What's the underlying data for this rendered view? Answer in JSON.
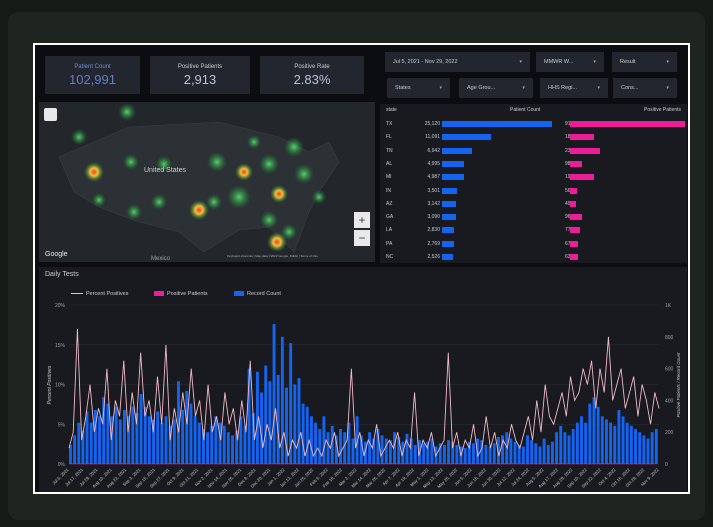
{
  "scorecards": [
    {
      "label": "Patient Count",
      "value": "102,991",
      "accent": "#5f7fc6"
    },
    {
      "label": "Positive Patients",
      "value": "2,913",
      "accent": "#b8c1d6"
    },
    {
      "label": "Positive Rate",
      "value": "2.83%",
      "accent": "#b8c1d6"
    }
  ],
  "filters": {
    "date_range": "Jul 5, 2021 - Nov 29, 2022",
    "mmwr": "MMWR W...",
    "result": "Result",
    "states": "States",
    "age_group": "Age Grou...",
    "hhs_region": "HHS Regi...",
    "cons": "Cons..."
  },
  "map": {
    "brand": "Google",
    "country_label": "United States",
    "country_label_2": "Mexico",
    "attribution": "Keyboard shortcuts | Map data ©2022 Google, INEGI | Terms of Use",
    "zoom_in": "+",
    "zoom_out": "−"
  },
  "table": {
    "col_state": "state",
    "col_patient_count": "Patient Count",
    "col_positive_patients": "Positive Patients",
    "max_patient": 25120,
    "max_positive": 915,
    "rows": [
      {
        "state": "TX",
        "patients": "25,120",
        "patients_n": 25120,
        "positives": "915",
        "positives_n": 915
      },
      {
        "state": "FL",
        "patients": "11,091",
        "patients_n": 11091,
        "positives": "187",
        "positives_n": 187
      },
      {
        "state": "TN",
        "patients": "6,942",
        "patients_n": 6942,
        "positives": "235",
        "positives_n": 235
      },
      {
        "state": "AL",
        "patients": "4,995",
        "patients_n": 4995,
        "positives": "98",
        "positives_n": 98
      },
      {
        "state": "MI",
        "patients": "4,987",
        "patients_n": 4987,
        "positives": "193",
        "positives_n": 193
      },
      {
        "state": "IN",
        "patients": "3,501",
        "patients_n": 3501,
        "positives": "56",
        "positives_n": 56
      },
      {
        "state": "AZ",
        "patients": "3,142",
        "patients_n": 3142,
        "positives": "49",
        "positives_n": 49
      },
      {
        "state": "GA",
        "patients": "3,090",
        "patients_n": 3090,
        "positives": "96",
        "positives_n": 96
      },
      {
        "state": "LA",
        "patients": "2,830",
        "patients_n": 2830,
        "positives": "77",
        "positives_n": 77
      },
      {
        "state": "PA",
        "patients": "2,769",
        "patients_n": 2769,
        "positives": "67",
        "positives_n": 67
      },
      {
        "state": "NC",
        "patients": "2,526",
        "patients_n": 2526,
        "positives": "63",
        "positives_n": 63
      }
    ]
  },
  "chart_data": {
    "type": "line",
    "title": "Daily Tests",
    "legend": [
      "Percent Positives",
      "Positive Patients",
      "Record Count"
    ],
    "colors": {
      "percent": "#f0b9c6",
      "positive": "#ec1d96",
      "record": "#1464f0"
    },
    "ylabel_left": "Percent Positives",
    "ylabel_right": "Positive Patients / Record Count",
    "yleft_ticks": [
      "0%",
      "5%",
      "10%",
      "15%",
      "20%"
    ],
    "yright_ticks": [
      "0",
      "200",
      "400",
      "600",
      "800",
      "1K"
    ],
    "xticks": [
      "Jul 5, 2021",
      "Jul 17, 2021",
      "Jul 29, 2021",
      "Aug 10, 2021",
      "Aug 22, 2021",
      "Sep 3, 2021",
      "Sep 15, 2021",
      "Sep 27, 2021",
      "Oct 9, 2021",
      "Oct 21, 2021",
      "Nov 2, 2021",
      "Nov 14, 2021",
      "Nov 26, 2021",
      "Dec 8, 2021",
      "Dec 20, 2021",
      "Jan 1, 2022",
      "Jan 13, 2022",
      "Jan 25, 2022",
      "Feb 6, 2022",
      "Feb 18, 2022",
      "Mar 2, 2022",
      "Mar 14, 2022",
      "Mar 26, 2022",
      "Apr 7, 2022",
      "Apr 19, 2022",
      "May 1, 2022",
      "May 13, 2022",
      "May 25, 2022",
      "Jun 6, 2022",
      "Jun 18, 2022",
      "Jun 30, 2022",
      "Jul 12, 2022",
      "Jul 24, 2022",
      "Aug 5, 2022",
      "Aug 17, 2022",
      "Aug 29, 2022",
      "Sep 10, 2022",
      "Sep 22, 2022",
      "Oct 4, 2022",
      "Oct 16, 2022",
      "Oct 28, 2022",
      "Nov 9, 2022"
    ],
    "record_count": [
      120,
      180,
      260,
      210,
      330,
      260,
      340,
      300,
      420,
      380,
      300,
      360,
      280,
      340,
      300,
      360,
      320,
      440,
      360,
      300,
      280,
      330,
      260,
      300,
      240,
      280,
      520,
      340,
      460,
      380,
      300,
      260,
      220,
      200,
      240,
      300,
      260,
      240,
      200,
      180,
      210,
      300,
      240,
      600,
      320,
      580,
      450,
      620,
      520,
      880,
      560,
      800,
      480,
      760,
      500,
      540,
      380,
      360,
      300,
      260,
      220,
      300,
      200,
      240,
      180,
      220,
      200,
      260,
      160,
      300,
      180,
      140,
      200,
      160,
      220,
      180,
      160,
      150,
      200,
      170,
      140,
      190,
      160,
      120,
      150,
      130,
      140,
      160,
      110,
      130,
      120,
      150,
      140,
      120,
      110,
      100,
      140,
      130,
      160,
      150,
      120,
      110,
      130,
      170,
      180,
      200,
      160,
      140,
      120,
      110,
      180,
      150,
      130,
      110,
      160,
      120,
      140,
      200,
      240,
      200,
      180,
      220,
      260,
      300,
      260,
      380,
      420,
      360,
      300,
      280,
      260,
      240,
      340,
      300,
      260,
      240,
      220,
      200,
      180,
      160,
      200,
      220
    ],
    "percent_positives": [
      2,
      4,
      17,
      3,
      6,
      10,
      4,
      7,
      5,
      12,
      3,
      8,
      6,
      13,
      4,
      9,
      5,
      14,
      6,
      8,
      4,
      11,
      5,
      15,
      3,
      7,
      4,
      9,
      5,
      12,
      6,
      8,
      3,
      10,
      4,
      6,
      3,
      9,
      5,
      7,
      3,
      8,
      4,
      13,
      3,
      6,
      2,
      5,
      3,
      7,
      2,
      4,
      1,
      3,
      2,
      4,
      1,
      3,
      1,
      2,
      1,
      3,
      2,
      4,
      1,
      2,
      3,
      12,
      2,
      4,
      1,
      3,
      2,
      5,
      1,
      2,
      3,
      2,
      4,
      1,
      3,
      2,
      9,
      1,
      3,
      2,
      4,
      1,
      2,
      3,
      14,
      2,
      4,
      1,
      3,
      2,
      5,
      1,
      2,
      6,
      2,
      4,
      1,
      3,
      2,
      5,
      3,
      2,
      4,
      6,
      3,
      8,
      4,
      10,
      6,
      5,
      7,
      9,
      6,
      11,
      8,
      9,
      12,
      10,
      13,
      7,
      12,
      9,
      16,
      8,
      10,
      12,
      7,
      9,
      11,
      6,
      10,
      8,
      5,
      9,
      7
    ]
  }
}
